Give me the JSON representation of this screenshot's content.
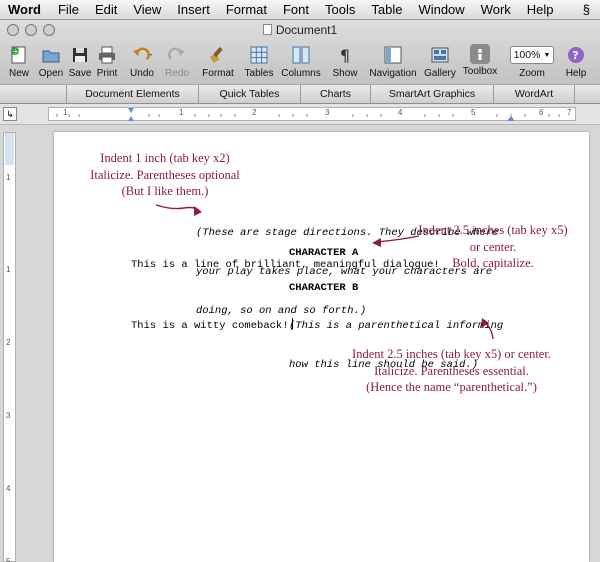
{
  "menubar": {
    "app": "Word",
    "items": [
      "File",
      "Edit",
      "View",
      "Insert",
      "Format",
      "Font",
      "Tools",
      "Table",
      "Window",
      "Work",
      "Help"
    ],
    "script_icon": "script-icon"
  },
  "window": {
    "title": "Document1"
  },
  "toolbar": {
    "new": "New",
    "open": "Open",
    "save": "Save",
    "print": "Print",
    "undo": "Undo",
    "redo": "Redo",
    "format": "Format",
    "tables": "Tables",
    "columns": "Columns",
    "show": "Show",
    "navigation": "Navigation",
    "gallery": "Gallery",
    "toolbox": "Toolbox",
    "zoom_value": "100%",
    "zoom": "Zoom",
    "help": "Help"
  },
  "ribbon_tabs": [
    "Document Elements",
    "Quick Tables",
    "Charts",
    "SmartArt Graphics",
    "WordArt"
  ],
  "ruler_numbers": [
    "1",
    "1",
    "2",
    "3",
    "4",
    "5",
    "6",
    "7"
  ],
  "vruler_numbers": [
    "1",
    "1",
    "2",
    "3",
    "4",
    "5"
  ],
  "script": {
    "stage_dir_1": "(These are stage directions. They describe where",
    "stage_dir_2": "your play takes place, what your characters are",
    "stage_dir_3": "doing, so on and so forth.)",
    "char_a": "CHARACTER A",
    "line_a": "This is a line of brilliant, meaningful dialogue!",
    "char_b": "CHARACTER B",
    "paren_1": "(This is a parenthetical informing",
    "paren_2": "how this line should be said.)",
    "line_b": "This is a witty comeback!"
  },
  "annotations": {
    "note1_l1": "Indent 1 inch (tab key x2)",
    "note1_l2": "Italicize. Parentheses optional",
    "note1_l3": "(But I like them.)",
    "note2_l1": "Indent 2.5 inches (tab key x5)",
    "note2_l2": "or center.",
    "note2_l3": "Bold, capitalize.",
    "note3_l1": "Indent 2.5 inches (tab key x5) or center.",
    "note3_l2": "Italicize. Parentheses essential.",
    "note3_l3": "(Hence the name “parenthetical.”)"
  },
  "colors": {
    "annotation": "#8b1a4a"
  }
}
